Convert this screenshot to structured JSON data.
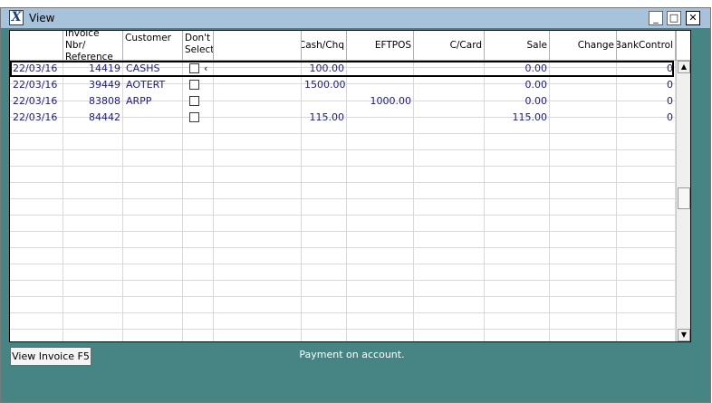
{
  "window": {
    "title": "View",
    "minimize": "_",
    "maximize": "□",
    "close": "✕"
  },
  "top_fragment": "...........",
  "columns": [
    {
      "key": "date",
      "label": ""
    },
    {
      "key": "invoice",
      "label": "Invoice Nbr/\nReference"
    },
    {
      "key": "customer",
      "label": "Customer"
    },
    {
      "key": "dont_select",
      "label": "Don't\nSelect"
    },
    {
      "key": "blank",
      "label": ""
    },
    {
      "key": "cash",
      "label": "Cash/Chq"
    },
    {
      "key": "eftpos",
      "label": "EFTPOS"
    },
    {
      "key": "ccard",
      "label": "C/Card"
    },
    {
      "key": "sale",
      "label": "Sale"
    },
    {
      "key": "change",
      "label": "Change"
    },
    {
      "key": "bankcontrol",
      "label": "BankControl"
    }
  ],
  "rows": [
    {
      "date": "22/03/16",
      "invoice": "14419",
      "customer": "CASHS",
      "checked": false,
      "marker": "‹",
      "cash": "100.00",
      "eftpos": "",
      "ccard": "",
      "sale": "0.00",
      "change": "",
      "bankcontrol": "0"
    },
    {
      "date": "22/03/16",
      "invoice": "39449",
      "customer": "AOTERT",
      "checked": false,
      "marker": "",
      "cash": "1500.00",
      "eftpos": "",
      "ccard": "",
      "sale": "0.00",
      "change": "",
      "bankcontrol": "0"
    },
    {
      "date": "22/03/16",
      "invoice": "83808",
      "customer": "ARPP",
      "checked": false,
      "marker": "",
      "cash": "",
      "eftpos": "1000.00",
      "ccard": "",
      "sale": "0.00",
      "change": "",
      "bankcontrol": "0"
    },
    {
      "date": "22/03/16",
      "invoice": "84442",
      "customer": "",
      "checked": false,
      "marker": "",
      "cash": "115.00",
      "eftpos": "",
      "ccard": "",
      "sale": "115.00",
      "change": "",
      "bankcontrol": "0"
    }
  ],
  "selected_row": 0,
  "scroll": {
    "up": "▲",
    "down": "▼"
  },
  "footer": {
    "view_invoice_label": "View Invoice F5",
    "status_message": "Payment on account."
  }
}
